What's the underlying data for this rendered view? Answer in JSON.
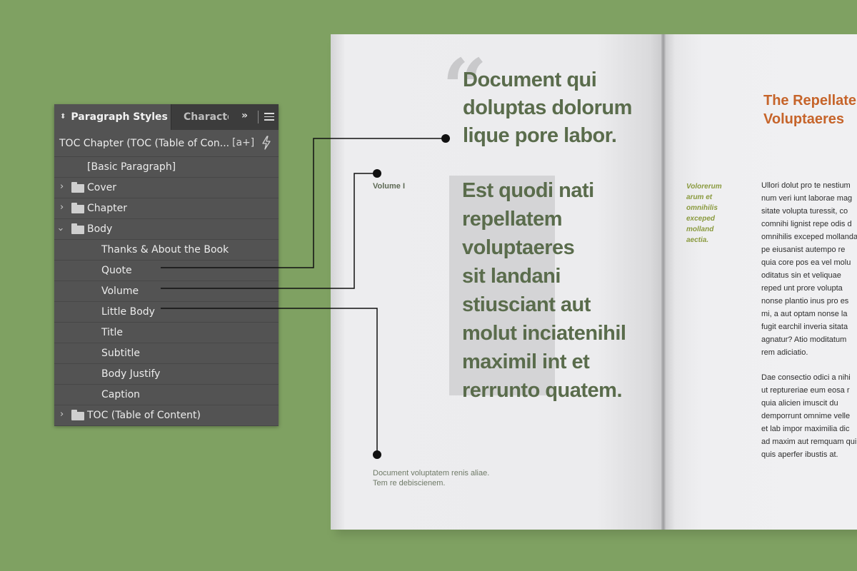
{
  "panel": {
    "tabs": {
      "active": "Paragraph Styles",
      "inactive": "Character Styles",
      "more": "»",
      "menu_icon": "hamburger-menu-icon"
    },
    "current_style": "TOC Chapter (TOC (Table of Con...",
    "new_style_label": "[a+]",
    "rows": [
      {
        "label": "[Basic Paragraph]",
        "level": 1,
        "folder": false
      },
      {
        "label": "Cover",
        "level": 0,
        "folder": true,
        "expanded": false
      },
      {
        "label": "Chapter",
        "level": 0,
        "folder": true,
        "expanded": false
      },
      {
        "label": "Body",
        "level": 0,
        "folder": true,
        "expanded": true
      },
      {
        "label": "Thanks & About the Book",
        "level": 2,
        "folder": false
      },
      {
        "label": "Quote",
        "level": 2,
        "folder": false
      },
      {
        "label": "Volume",
        "level": 2,
        "folder": false
      },
      {
        "label": "Little Body",
        "level": 2,
        "folder": false
      },
      {
        "label": "Title",
        "level": 2,
        "folder": false
      },
      {
        "label": "Subtitle",
        "level": 2,
        "folder": false
      },
      {
        "label": "Body Justify",
        "level": 2,
        "folder": false
      },
      {
        "label": "Caption",
        "level": 2,
        "folder": false
      },
      {
        "label": "TOC (Table of Content)",
        "level": 0,
        "folder": true,
        "expanded": false
      }
    ]
  },
  "book": {
    "quote_mark": "“",
    "quote_lines": [
      "Document qui",
      "doluptas dolorum",
      "lique pore labor."
    ],
    "volume_label": "Volume I",
    "volume_lines": [
      "Est quodi nati",
      "repellatem",
      "voluptaeres",
      "sit landani",
      "stiusciant aut",
      "molut inciatenihil",
      "maximil int et",
      "rerrunto quatem."
    ],
    "little_body_lines": [
      "Document voluptatem renis aliae.",
      "Tem re debiscienem."
    ],
    "right_title_lines": [
      "The Repellatem",
      "Voluptaeres"
    ],
    "side_note_lines": [
      "Volorerum",
      "arum et",
      "omnihilis",
      "exceped",
      "molland",
      "aectia."
    ],
    "body_paragraphs": [
      [
        "Ullori dolut pro te nestium",
        "num veri iunt laborae mag",
        "sitate volupta turessit, co",
        "comnihi lignist repe odis d",
        "omnihilis exceped mollanda",
        "pe eiusanist autempo re",
        "quia core pos ea vel molu",
        "oditatus sin et veliquae",
        "reped unt prore volupta",
        "nonse plantio inus pro es",
        "mi, a aut optam nonse la",
        "fugit earchil inveria sitata",
        "agnatur? Atio moditatum",
        "rem adiciatio."
      ],
      [
        "Dae consectio odici a nihi",
        "ut reptureriae eum eosa r",
        "quia alicien imuscit du",
        "demporrunt omnime velle",
        "et lab impor maximilia dic",
        "ad maxim aut remquam qui",
        "quis aperfer ibustis at."
      ]
    ]
  },
  "colors": {
    "background": "#7fa162",
    "panel": "#535353",
    "olive_text": "#5a6c4c",
    "orange_title": "#c6642a"
  }
}
